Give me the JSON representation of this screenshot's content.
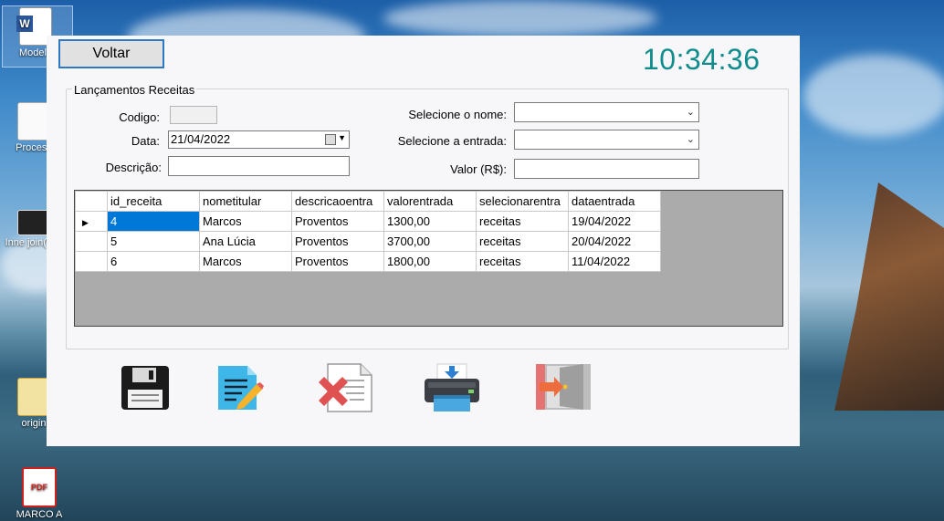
{
  "desktop": {
    "icons": [
      {
        "label": "Modelo"
      },
      {
        "label": "Process"
      },
      {
        "label": "Inne join(Vali"
      },
      {
        "label": "origin"
      },
      {
        "label": "MARCO A"
      }
    ]
  },
  "window": {
    "back_button": "Voltar",
    "clock": "10:34:36",
    "group_title": "Lançamentos Receitas",
    "form": {
      "codigo_label": "Codigo:",
      "codigo_value": "",
      "data_label": "Data:",
      "data_value": "21/04/2022",
      "descricao_label": "Descrição:",
      "descricao_value": "",
      "nome_label": "Selecione o nome:",
      "nome_value": "",
      "entrada_label": "Selecione a entrada:",
      "entrada_value": "",
      "valor_label": "Valor (R$):",
      "valor_value": ""
    },
    "grid": {
      "columns": [
        "id_receita",
        "nometitular",
        "descricaoentra",
        "valorentrada",
        "selecionarentra",
        "dataentrada"
      ],
      "rows": [
        [
          "4",
          "Marcos",
          "Proventos",
          "1300,00",
          "receitas",
          "19/04/2022"
        ],
        [
          "5",
          "Ana Lúcia",
          "Proventos",
          "3700,00",
          "receitas",
          "20/04/2022"
        ],
        [
          "6",
          "Marcos",
          "Proventos",
          "1800,00",
          "receitas",
          "11/04/2022"
        ]
      ]
    },
    "toolbar": [
      {
        "icon": "save-icon"
      },
      {
        "icon": "edit-icon"
      },
      {
        "icon": "delete-icon"
      },
      {
        "icon": "print-icon"
      },
      {
        "icon": "exit-icon"
      }
    ]
  },
  "colors": {
    "clock": "#108c8c",
    "selection": "#0078d7",
    "button_border": "#2e78c4"
  }
}
